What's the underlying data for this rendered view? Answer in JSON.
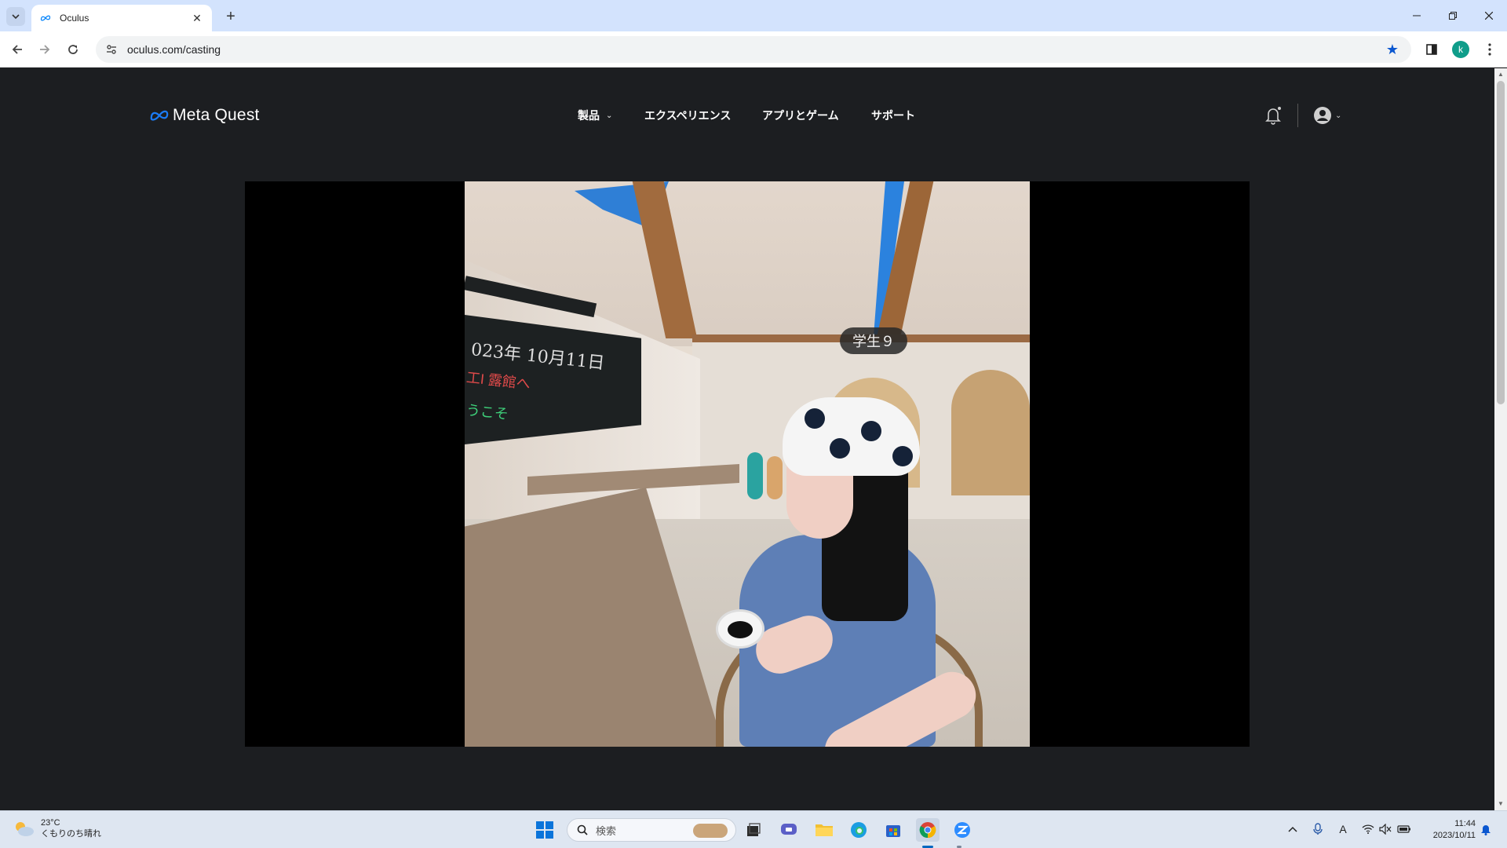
{
  "browser": {
    "tab_title": "Oculus",
    "url": "oculus.com/casting",
    "profile_initial": "k"
  },
  "header": {
    "logo_text": "Meta Quest",
    "nav": [
      {
        "label": "製品"
      },
      {
        "label": "エクスペリエンス"
      },
      {
        "label": "アプリとゲーム"
      },
      {
        "label": "サポート"
      }
    ]
  },
  "cast": {
    "nametag": "学生９",
    "board_line1": "023年 10月11日",
    "board_line2": "工I 露館へ",
    "board_line3": "うこそ"
  },
  "taskbar": {
    "weather_temp": "23°C",
    "weather_cond": "くもりのち晴れ",
    "search_label": "検索",
    "time": "11:44",
    "date": "2023/10/11",
    "ime": "A"
  },
  "colors": {
    "page_bg": "#1c1e21",
    "tabbar": "#d3e3fd",
    "accent": "#0b57d0"
  }
}
